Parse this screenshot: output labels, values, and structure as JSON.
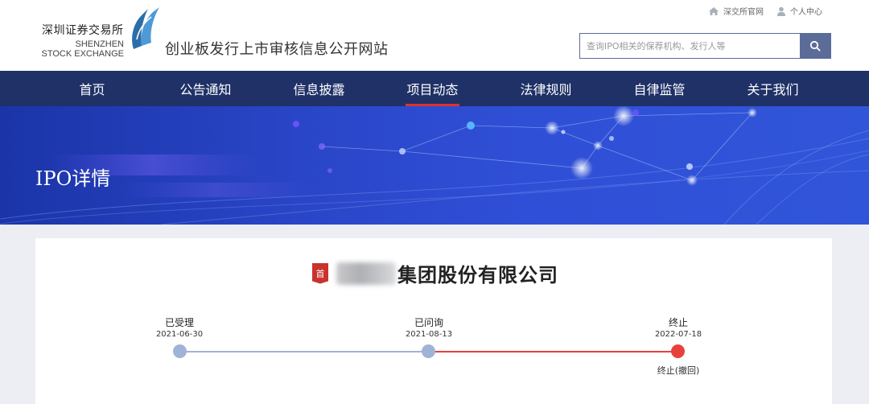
{
  "header": {
    "logo_cn": "深圳证券交易所",
    "logo_en_line1": "SHENZHEN",
    "logo_en_line2": "STOCK EXCHANGE",
    "site_title": "创业板发行上市审核信息公开网站",
    "top_links": [
      {
        "label": "深交所官网",
        "icon": "home-icon"
      },
      {
        "label": "个人中心",
        "icon": "user-icon"
      }
    ],
    "search": {
      "placeholder": "查询IPO相关的保荐机构、发行人等",
      "button_icon": "search-icon"
    }
  },
  "nav": {
    "items": [
      {
        "label": "首页"
      },
      {
        "label": "公告通知"
      },
      {
        "label": "信息披露"
      },
      {
        "label": "项目动态"
      },
      {
        "label": "法律规则"
      },
      {
        "label": "自律监管"
      },
      {
        "label": "关于我们"
      }
    ],
    "active_index": 3
  },
  "banner": {
    "title": "IPO详情"
  },
  "company": {
    "tag": "首",
    "name": "集团股份有限公司"
  },
  "timeline": {
    "steps": [
      {
        "label": "已受理",
        "date": "2021-06-30",
        "sub": ""
      },
      {
        "label": "已问询",
        "date": "2021-08-13",
        "sub": ""
      },
      {
        "label": "终止",
        "date": "2022-07-18",
        "sub": "终止(撤回)"
      }
    ],
    "colors": {
      "done": "#9fb3d6",
      "terminated": "#e8403a"
    }
  },
  "colors": {
    "nav_bg": "#1f3167",
    "accent_red": "#d9332f",
    "search_btn": "#5b6c98"
  }
}
